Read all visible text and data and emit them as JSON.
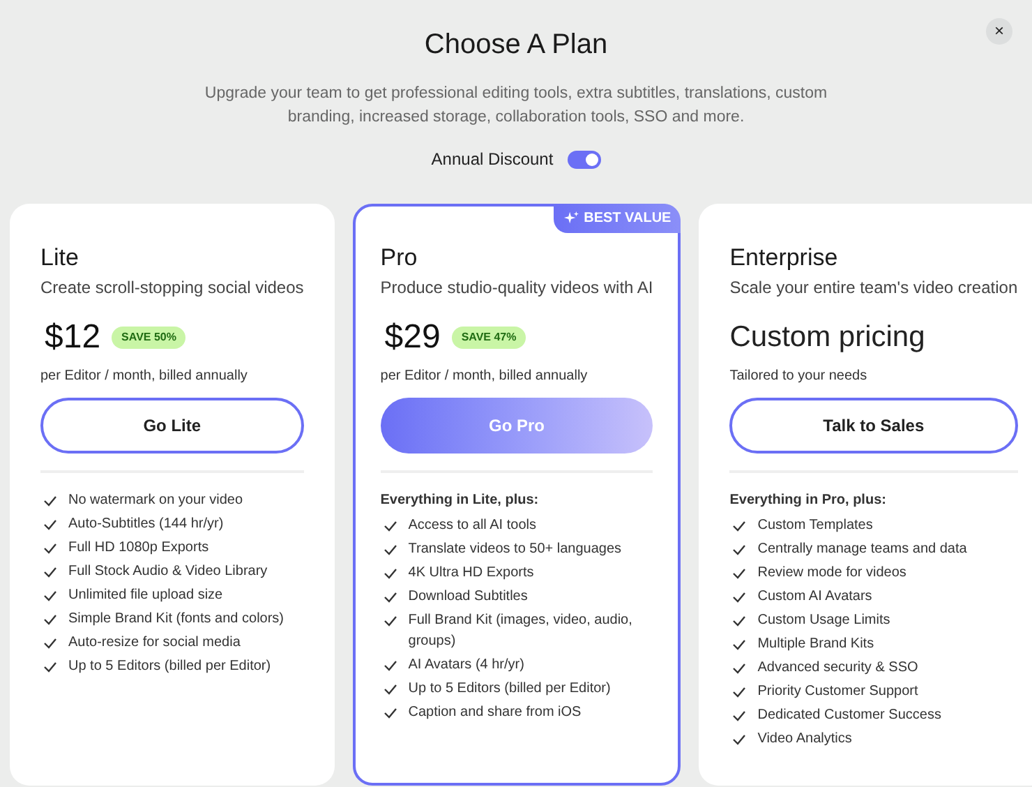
{
  "title": "Choose A Plan",
  "subtitle": "Upgrade your team to get professional editing tools, extra subtitles, translations, custom branding, increased storage, collaboration tools, SSO and more.",
  "close": "×",
  "annual_discount": {
    "label": "Annual Discount",
    "on": true
  },
  "plans": [
    {
      "name": "Lite",
      "tagline": "Create scroll-stopping social videos",
      "price": "$12",
      "kind": "amount",
      "save": "SAVE 50%",
      "price_note": "per Editor / month, billed annually",
      "button": {
        "label": "Go Lite",
        "primary": false
      },
      "featured": false,
      "features": [
        "No watermark on your video",
        "Auto-Subtitles (144 hr/yr)",
        "Full HD 1080p Exports",
        "Full Stock Audio & Video Library",
        "Unlimited file upload size",
        "Simple Brand Kit (fonts and colors)",
        "Auto-resize for social media",
        "Up to 5 Editors (billed per Editor)"
      ]
    },
    {
      "name": "Pro",
      "tagline": "Produce studio-quality videos with AI",
      "price": "$29",
      "kind": "amount",
      "save": "SAVE 47%",
      "price_note": "per Editor / month, billed annually",
      "button": {
        "label": "Go Pro",
        "primary": true
      },
      "featured": true,
      "badge": "BEST VALUE",
      "features_heading": "Everything in Lite, plus:",
      "features": [
        "Access to all AI tools",
        "Translate videos to 50+ languages",
        "4K Ultra HD Exports",
        "Download Subtitles",
        "Full Brand Kit (images, video, audio, groups)",
        "AI Avatars (4 hr/yr)",
        "Up to 5 Editors (billed per Editor)",
        "Caption and share from iOS"
      ]
    },
    {
      "name": "Enterprise",
      "tagline": "Scale your entire team's video creation",
      "price": "Custom pricing",
      "kind": "custom",
      "price_note": "Tailored to your needs",
      "button": {
        "label": "Talk to Sales",
        "primary": false
      },
      "featured": false,
      "features_heading": "Everything in Pro, plus:",
      "features": [
        "Custom Templates",
        "Centrally manage teams and data",
        "Review mode for videos",
        "Custom AI Avatars",
        "Custom Usage Limits",
        "Multiple Brand Kits",
        "Advanced security & SSO",
        "Priority Customer Support",
        "Dedicated Customer Success",
        "Video Analytics"
      ]
    }
  ]
}
